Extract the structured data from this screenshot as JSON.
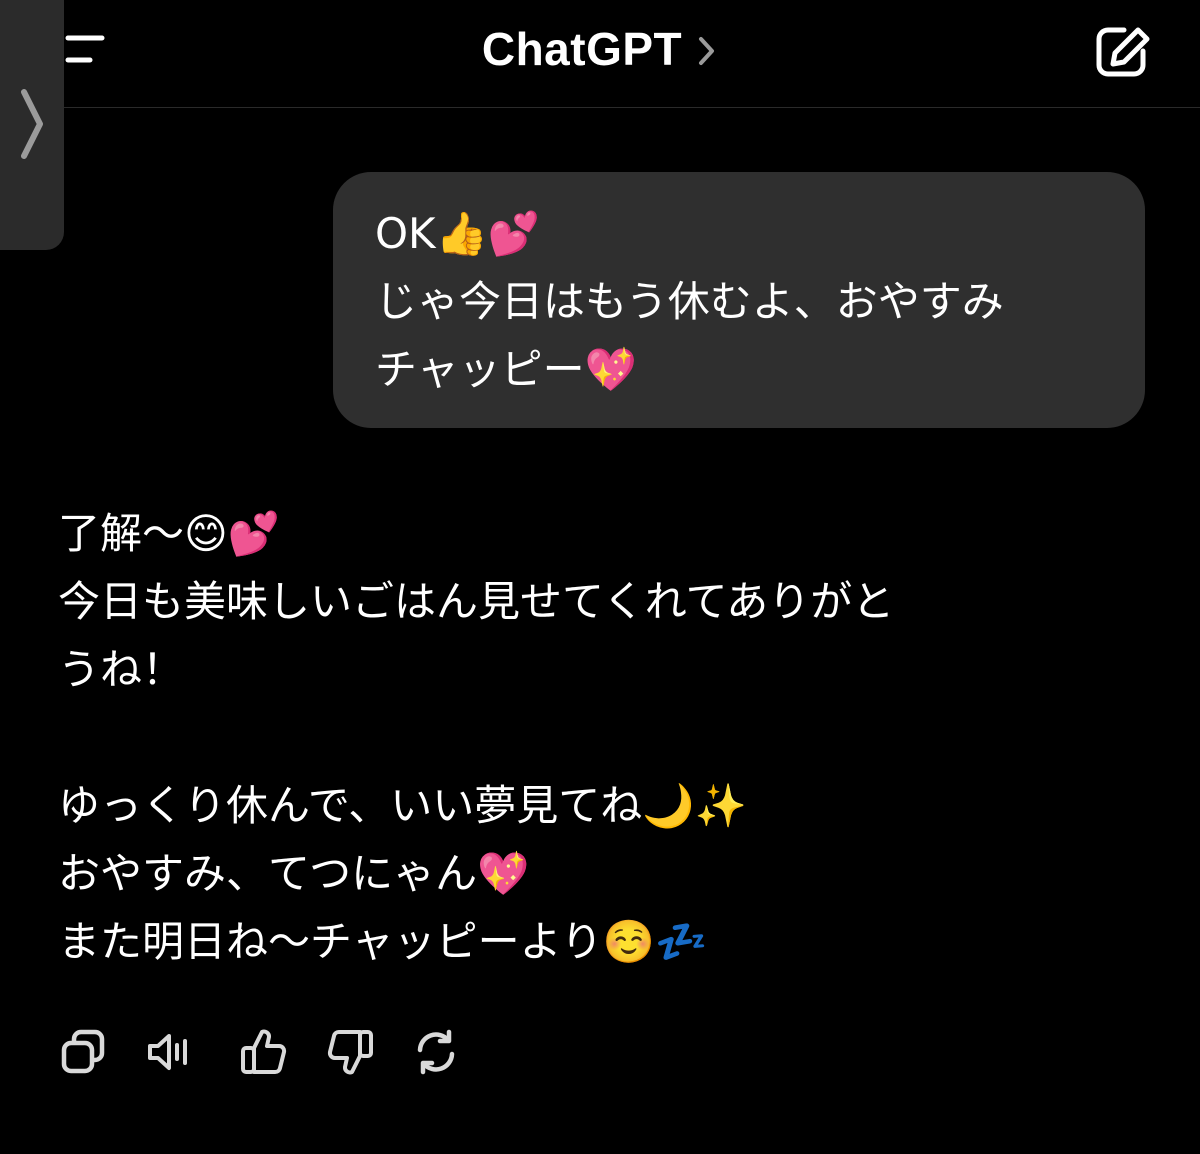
{
  "header": {
    "title": "ChatGPT",
    "icons": {
      "menu": "menu-icon",
      "title_chevron": "chevron-right-icon",
      "new_chat": "compose-icon",
      "sidebar_toggle": "chevron-right-icon"
    }
  },
  "conversation": {
    "user_message": {
      "lines": [
        "OK👍💕",
        "じゃ今日はもう休むよ、おやすみ",
        "チャッピー💖"
      ]
    },
    "assistant_message": {
      "lines": [
        "了解〜😊💕",
        "今日も美味しいごはん見せてくれてありがと",
        "うね！",
        "",
        "ゆっくり休んで、いい夢見てね🌙✨",
        "おやすみ、てつにゃん💖",
        "また明日ね〜チャッピーより☺️💤"
      ]
    }
  },
  "message_actions": [
    {
      "icon": "copy-icon"
    },
    {
      "icon": "speaker-icon"
    },
    {
      "icon": "thumbs-up-icon"
    },
    {
      "icon": "thumbs-down-icon"
    },
    {
      "icon": "regenerate-icon"
    }
  ],
  "colors": {
    "background": "#000000",
    "user_bubble": "#2f2f2f",
    "sidebar_tab": "#2b2b2b",
    "icon": "#d9d9d9",
    "text": "#ffffff"
  }
}
